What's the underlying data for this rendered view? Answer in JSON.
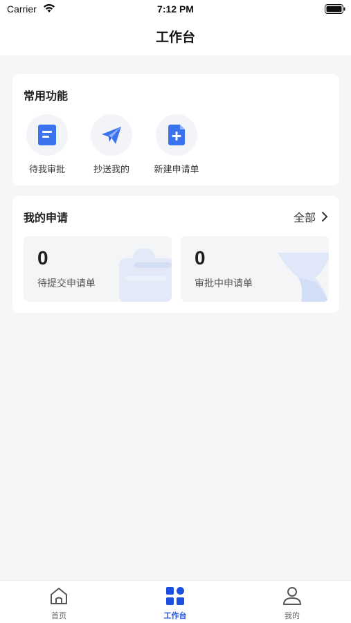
{
  "status_bar": {
    "carrier": "Carrier",
    "time": "7:12 PM"
  },
  "nav": {
    "title": "工作台"
  },
  "common": {
    "title": "常用功能",
    "items": [
      {
        "label": "待我审批",
        "icon": "document-icon"
      },
      {
        "label": "抄送我的",
        "icon": "paper-plane-icon"
      },
      {
        "label": "新建申请单",
        "icon": "new-file-icon"
      }
    ]
  },
  "my_applications": {
    "title": "我的申请",
    "view_all": "全部",
    "stats": [
      {
        "value": "0",
        "label": "待提交申请单"
      },
      {
        "value": "0",
        "label": "审批中申请单"
      }
    ]
  },
  "tabs": [
    {
      "label": "首页",
      "icon": "home-icon",
      "active": false
    },
    {
      "label": "工作台",
      "icon": "grid-icon",
      "active": true
    },
    {
      "label": "我的",
      "icon": "user-icon",
      "active": false
    }
  ],
  "colors": {
    "accent": "#1c4fe0",
    "icon_blue": "#3b72ee",
    "background": "#f5f6f8"
  }
}
